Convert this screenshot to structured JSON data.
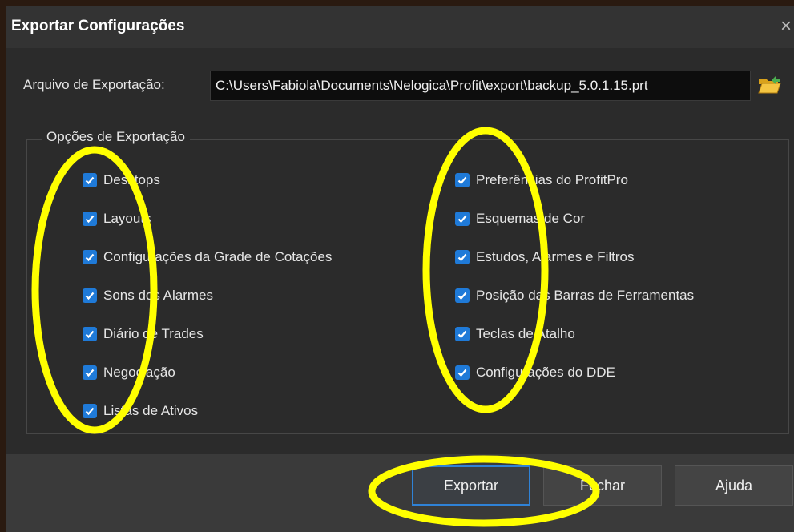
{
  "dialog": {
    "title": "Exportar Configurações",
    "close_glyph": "×"
  },
  "file": {
    "label": "Arquivo de Exportação:",
    "path": "C:\\Users\\Fabiola\\Documents\\Nelogica\\Profit\\export\\backup_5.0.1.15.prt",
    "browse_icon": "folder-open-icon"
  },
  "options": {
    "group_title": "Opções de Exportação",
    "left": [
      {
        "label": "Desktops",
        "checked": true
      },
      {
        "label": "Layouts",
        "checked": true
      },
      {
        "label": "Configurações da Grade de Cotações",
        "checked": true
      },
      {
        "label": "Sons dos Alarmes",
        "checked": true
      },
      {
        "label": "Diário de Trades",
        "checked": true
      },
      {
        "label": "Negociação",
        "checked": true
      },
      {
        "label": "Listas de Ativos",
        "checked": true
      }
    ],
    "right": [
      {
        "label": "Preferências do ProfitPro",
        "checked": true
      },
      {
        "label": "Esquemas de Cor",
        "checked": true
      },
      {
        "label": "Estudos, Alarmes e Filtros",
        "checked": true
      },
      {
        "label": "Posição das Barras de Ferramentas",
        "checked": true
      },
      {
        "label": "Teclas de Atalho",
        "checked": true
      },
      {
        "label": "Configurações do DDE",
        "checked": true
      }
    ]
  },
  "buttons": {
    "export": "Exportar",
    "close": "Fechar",
    "help": "Ajuda"
  },
  "colors": {
    "checkbox": "#1f7ad8",
    "highlight": "#ffff00",
    "primary_border": "#2f82d6"
  }
}
